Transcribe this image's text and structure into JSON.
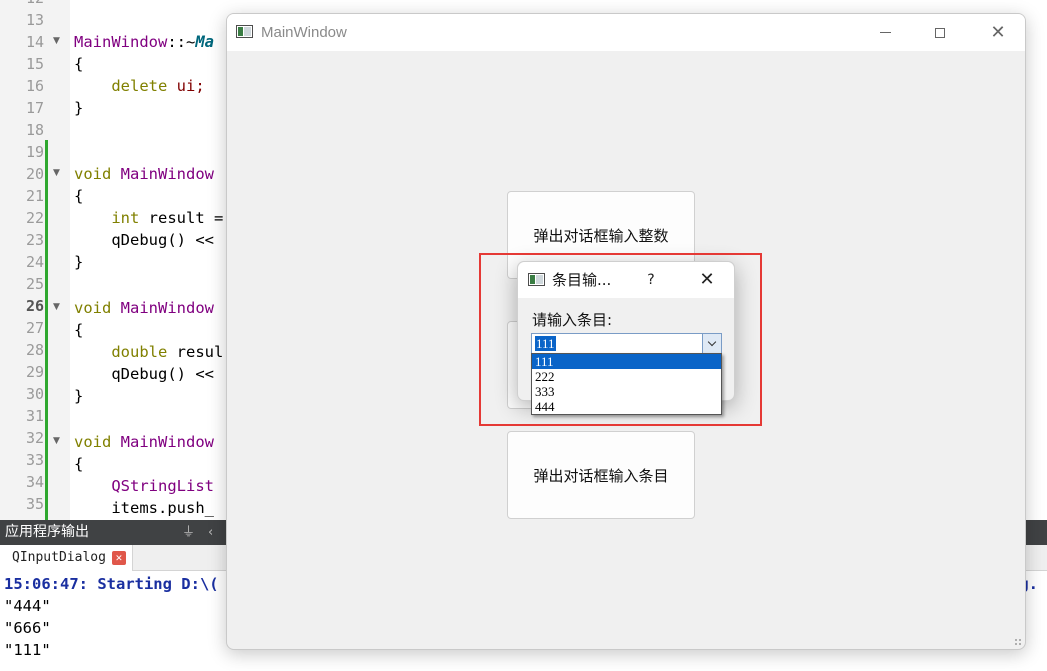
{
  "editor": {
    "line_numbers": [
      "12",
      "13",
      "14",
      "15",
      "16",
      "17",
      "18",
      "19",
      "20",
      "21",
      "22",
      "23",
      "24",
      "25",
      "26",
      "27",
      "28",
      "29",
      "30",
      "31",
      "32",
      "33",
      "34",
      "35"
    ],
    "lines": {
      "l14_class": "MainWindow",
      "l14_sep": "::~",
      "l14_member": "Ma",
      "l15": "{",
      "l16_kw": "delete",
      "l16_rest": " ui;",
      "l17": "}",
      "l20_kw": "void",
      "l20_fn": " MainWindow",
      "l21": "{",
      "l22_kw": "int",
      "l22_rest": " result =",
      "l23": "qDebug() <<",
      "l24": "}",
      "l26_kw": "void",
      "l26_fn": " MainWindow",
      "l27": "{",
      "l28_kw": "double",
      "l28_rest": " resul",
      "l29": "qDebug() <<",
      "l30": "}",
      "l32_kw": "void",
      "l32_fn": " MainWindow",
      "l33": "{",
      "l34_type": "QStringList",
      "l35": "items.push_"
    }
  },
  "output": {
    "title": "应用程序输出",
    "tab_label": "QInputDialog",
    "tab_close": "✕",
    "lines": [
      "15:06:47: Starting D:\\(",
      "\"444\"",
      "\"666\"",
      "\"111\""
    ],
    "line_tail": "og."
  },
  "main_window": {
    "title": "MainWindow",
    "buttons": {
      "int": "弹出对话框输入整数",
      "item": "弹出对话框输入条目"
    }
  },
  "dialog": {
    "title": "条目输...",
    "help": "?",
    "close": "✕",
    "prompt": "请输入条目:",
    "combo_value": "111",
    "options": [
      "111",
      "222",
      "333",
      "444"
    ],
    "selected_index": 0
  },
  "colors": {
    "highlight": "#e53935",
    "selection": "#0a64c8",
    "keyword": "#808000",
    "function": "#800080"
  }
}
